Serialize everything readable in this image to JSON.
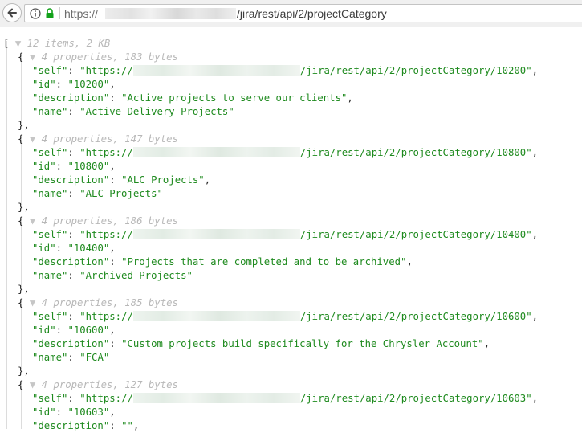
{
  "browser": {
    "url_scheme": "https://",
    "url_path": "/jira/rest/api/2/projectCategory"
  },
  "json_view": {
    "root_open": "[",
    "root_meta": "12 items, 2 KB",
    "key_self": "\"self\"",
    "key_id": "\"id\"",
    "key_description": "\"description\"",
    "key_name": "\"name\"",
    "url_prefix": "\"https://",
    "items": [
      {
        "meta": "4 properties, 183 bytes",
        "self_suffix": "/jira/rest/api/2/projectCategory/10200\"",
        "id": "\"10200\"",
        "description": "\"Active projects to serve our clients\"",
        "name": "\"Active Delivery Projects\""
      },
      {
        "meta": "4 properties, 147 bytes",
        "self_suffix": "/jira/rest/api/2/projectCategory/10800\"",
        "id": "\"10800\"",
        "description": "\"ALC Projects\"",
        "name": "\"ALC Projects\""
      },
      {
        "meta": "4 properties, 186 bytes",
        "self_suffix": "/jira/rest/api/2/projectCategory/10400\"",
        "id": "\"10400\"",
        "description": "\"Projects that are completed and to be archived\"",
        "name": "\"Archived Projects\""
      },
      {
        "meta": "4 properties, 185 bytes",
        "self_suffix": "/jira/rest/api/2/projectCategory/10600\"",
        "id": "\"10600\"",
        "description": "\"Custom projects build specifically for the Chrysler Account\"",
        "name": "\"FCA\""
      },
      {
        "meta": "4 properties, 127 bytes",
        "self_suffix": "/jira/rest/api/2/projectCategory/10603\"",
        "id": "\"10603\"",
        "description": "\"\""
      }
    ]
  }
}
